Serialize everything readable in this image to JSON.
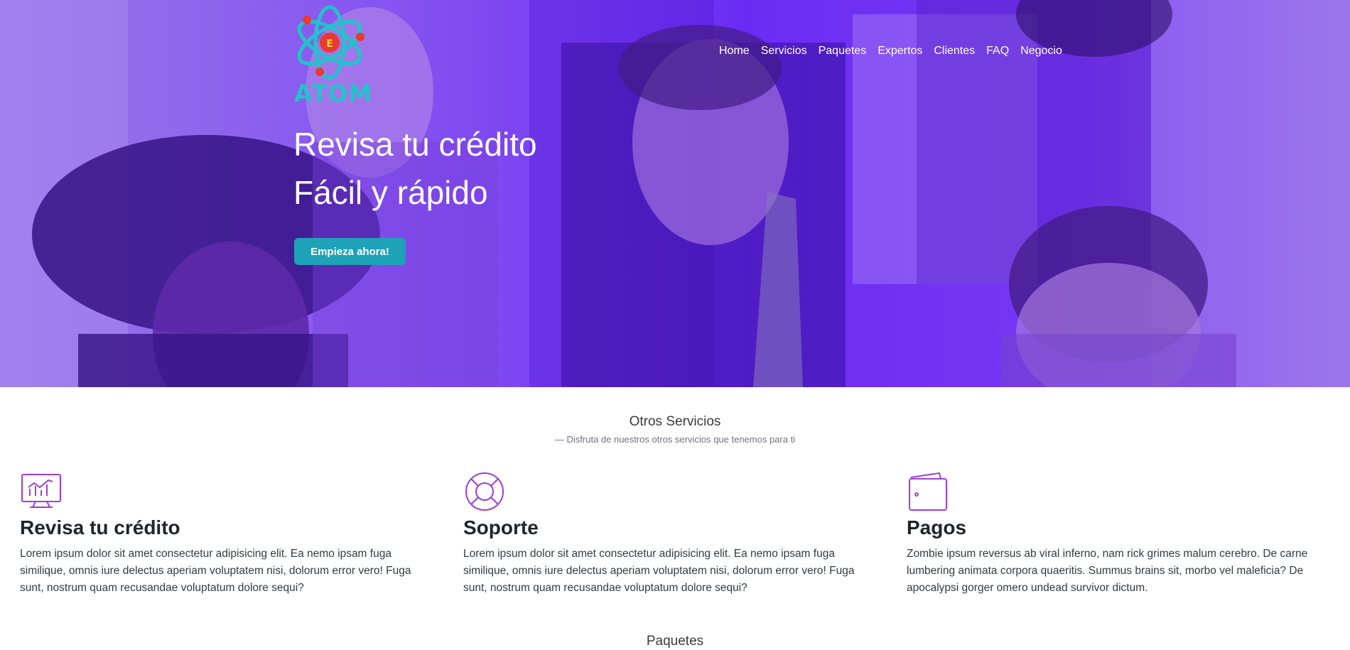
{
  "brand": {
    "logo_text": "ATOM"
  },
  "nav": {
    "items": [
      "Home",
      "Servicios",
      "Paquetes",
      "Expertos",
      "Clientes",
      "FAQ",
      "Negocio"
    ]
  },
  "hero": {
    "line1": "Revisa tu crédito",
    "line2": "Fácil y rápido",
    "cta_label": "Empieza ahora!"
  },
  "services_section": {
    "title": "Otros Servicios",
    "subtitle": "—  Disfruta de nuestros otros servicios que tenemos para ti"
  },
  "services": [
    {
      "icon": "monitor-chart-icon",
      "title": "Revisa tu crédito",
      "text": "Lorem ipsum dolor sit amet consectetur adipisicing elit. Ea nemo ipsam fuga similique, omnis iure delectus aperiam voluptatem nisi, dolorum error vero! Fuga sunt, nostrum quam recusandae voluptatum dolore sequi?"
    },
    {
      "icon": "lifebuoy-icon",
      "title": "Soporte",
      "text": "Lorem ipsum dolor sit amet consectetur adipisicing elit. Ea nemo ipsam fuga similique, omnis iure delectus aperiam voluptatem nisi, dolorum error vero! Fuga sunt, nostrum quam recusandae voluptatum dolore sequi?"
    },
    {
      "icon": "wallet-icon",
      "title": "Pagos",
      "text": "Zombie ipsum reversus ab viral inferno, nam rick grimes malum cerebro. De carne lumbering animata corpora quaeritis. Summus brains sit, morbo vel maleficia? De apocalypsi gorger omero undead survivor dictum."
    }
  ],
  "packages_section": {
    "title": "Paquetes"
  },
  "colors": {
    "hero_overlay": "#6a2ef5",
    "accent_teal": "#1ea2b8",
    "logo_teal": "#22c3c9",
    "icon_purple": "#9b3fd8"
  }
}
